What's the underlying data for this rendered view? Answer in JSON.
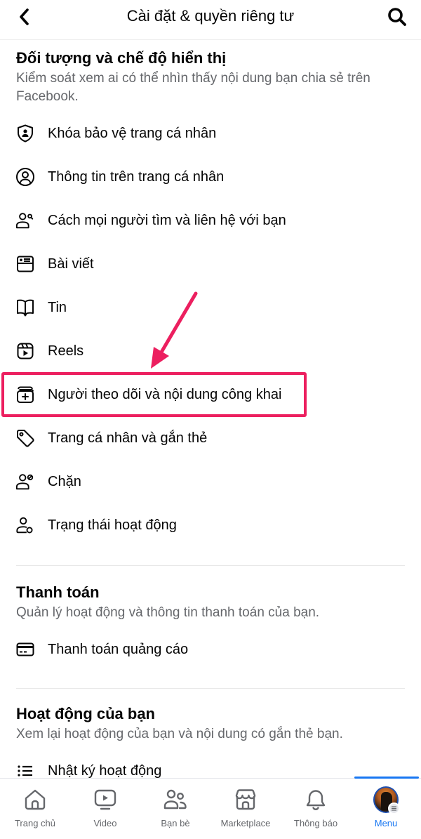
{
  "header": {
    "title": "Cài đặt & quyền riêng tư",
    "back_icon": "chevron-left-icon",
    "search_icon": "search-icon"
  },
  "sections": [
    {
      "title": "Đối tượng và chế độ hiển thị",
      "description": "Kiểm soát xem ai có thể nhìn thấy nội dung bạn chia sẻ trên Facebook.",
      "items": [
        {
          "label": "Khóa bảo vệ trang cá nhân",
          "icon": "shield-person-icon"
        },
        {
          "label": "Thông tin trên trang cá nhân",
          "icon": "person-circle-icon"
        },
        {
          "label": "Cách mọi người tìm và liên hệ với bạn",
          "icon": "person-search-icon"
        },
        {
          "label": "Bài viết",
          "icon": "post-icon"
        },
        {
          "label": "Tin",
          "icon": "book-open-icon"
        },
        {
          "label": "Reels",
          "icon": "reels-icon"
        },
        {
          "label": "Người theo dõi và nội dung công khai",
          "icon": "stack-plus-icon",
          "highlighted": true
        },
        {
          "label": "Trang cá nhân và gắn thẻ",
          "icon": "tag-icon"
        },
        {
          "label": "Chặn",
          "icon": "person-block-icon"
        },
        {
          "label": "Trạng thái hoạt động",
          "icon": "person-status-icon"
        }
      ]
    },
    {
      "title": "Thanh toán",
      "description": "Quản lý hoạt động và thông tin thanh toán của bạn.",
      "items": [
        {
          "label": "Thanh toán quảng cáo",
          "icon": "credit-card-icon"
        }
      ]
    },
    {
      "title": "Hoạt động của bạn",
      "description": "Xem lại hoạt động của bạn và nội dung có gắn thẻ bạn.",
      "items": [
        {
          "label": "Nhật ký hoạt động",
          "icon": "list-icon"
        }
      ]
    }
  ],
  "annotation": {
    "color": "#ec1f5f",
    "target": "Người theo dõi và nội dung công khai"
  },
  "tabbar": {
    "active": "Menu",
    "accent": "#1877f2",
    "tabs": [
      {
        "label": "Trang chủ",
        "icon": "home-icon"
      },
      {
        "label": "Video",
        "icon": "video-icon"
      },
      {
        "label": "Bạn bè",
        "icon": "friends-icon"
      },
      {
        "label": "Marketplace",
        "icon": "marketplace-icon"
      },
      {
        "label": "Thông báo",
        "icon": "bell-icon"
      },
      {
        "label": "Menu",
        "icon": "avatar-menu-icon"
      }
    ]
  }
}
